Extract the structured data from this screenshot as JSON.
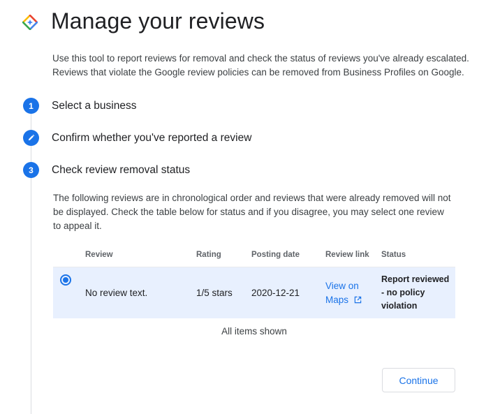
{
  "header": {
    "title": "Manage your reviews",
    "logo_icon": "google-business-diamond-icon"
  },
  "intro": {
    "text": "Use this tool to report reviews for removal and check the status of reviews you've already escalated. Reviews that violate the Google review policies can be removed from Business Profiles on Google."
  },
  "steps": [
    {
      "marker": "1",
      "label": "Select a business",
      "state": "complete"
    },
    {
      "marker": "",
      "marker_icon": "pencil-icon",
      "label": "Confirm whether you've reported a review",
      "state": "editing"
    },
    {
      "marker": "3",
      "label": "Check review removal status",
      "state": "active"
    }
  ],
  "step3": {
    "description": "The following reviews are in chronological order and reviews that were already removed will not be displayed. Check the table below for status and if you disagree, you may select one review to appeal it."
  },
  "table": {
    "headers": {
      "review": "Review",
      "rating": "Rating",
      "posting_date": "Posting date",
      "review_link": "Review link",
      "status": "Status"
    },
    "rows": [
      {
        "selected": true,
        "review": "No review text.",
        "rating": "1/5 stars",
        "posting_date": "2020-12-21",
        "link_text_1": "View on",
        "link_text_2": "Maps",
        "link_icon": "external-link-icon",
        "status_1": "Report reviewed",
        "status_2": "- no policy",
        "status_3": "violation"
      }
    ],
    "footer": "All items shown"
  },
  "actions": {
    "continue_label": "Continue"
  },
  "colors": {
    "accent": "#1a73e8",
    "row_selected": "#e8f0fe"
  }
}
